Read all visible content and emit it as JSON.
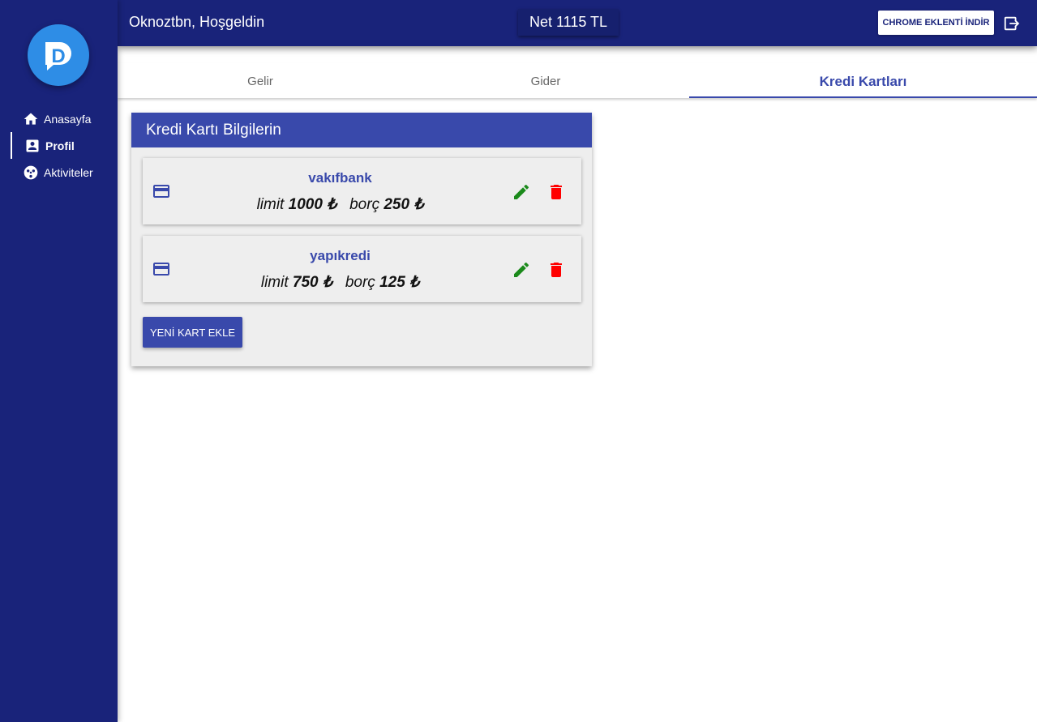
{
  "sidebar": {
    "logo_letter": "D",
    "items": [
      {
        "label": "Anasayfa",
        "icon": "home-icon"
      },
      {
        "label": "Profil",
        "icon": "account-box-icon"
      },
      {
        "label": "Aktiviteler",
        "icon": "activities-icon"
      }
    ],
    "active_item": "Profil"
  },
  "header": {
    "greeting": "Oknoztbn, Hoşgeldin",
    "net_total": "Net 1115 TL",
    "chrome_button_label": "CHROME EKLENTİ İNDİR",
    "logout_icon": "logout-icon"
  },
  "tabs": [
    {
      "label": "Gelir"
    },
    {
      "label": "Gider"
    },
    {
      "label": "Kredi Kartları"
    }
  ],
  "active_tab": "Kredi Kartları",
  "panel": {
    "title": "Kredi Kartı Bilgilerin",
    "cards": [
      {
        "bank": "vakıfbank",
        "limit_label": "limit",
        "limit": "1000 ₺",
        "debt_label": "borç",
        "debt": "250 ₺"
      },
      {
        "bank": "yapıkredi",
        "limit_label": "limit",
        "limit": "750 ₺",
        "debt_label": "borç",
        "debt": "125 ₺"
      }
    ],
    "add_button_label": "YENİ KART EKLE"
  },
  "colors": {
    "sidebar": "#19237a",
    "accent": "#3949ab",
    "edit": "#1b8a1b",
    "delete": "#ff0000"
  }
}
